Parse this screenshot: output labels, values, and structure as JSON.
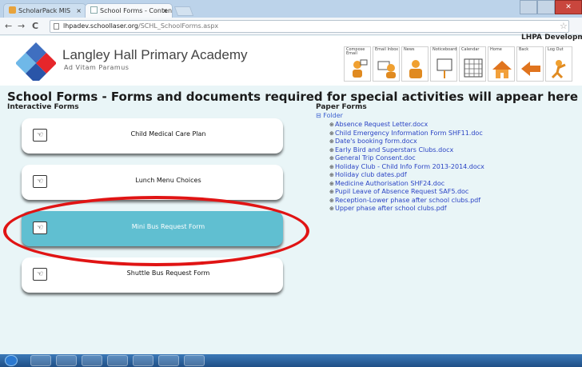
{
  "browser": {
    "tabs": [
      {
        "title": "ScholarPack MIS",
        "active": false
      },
      {
        "title": "School Forms - Content",
        "active": true
      }
    ],
    "address": {
      "host": "lhpadev.schoollaser.org",
      "path": "/SCHL_SchoolForms.aspx"
    }
  },
  "header": {
    "school_name": "Langley Hall Primary Academy",
    "motto": "Ad Vitam Paramus",
    "user_label": "LHPA Developme",
    "nav": [
      {
        "label": "Compose Email",
        "icon": "compose-email-icon"
      },
      {
        "label": "Email Inbox",
        "icon": "email-inbox-icon"
      },
      {
        "label": "News",
        "icon": "news-icon"
      },
      {
        "label": "Noticeboard",
        "icon": "noticeboard-icon"
      },
      {
        "label": "Calendar",
        "icon": "calendar-icon"
      },
      {
        "label": "Home",
        "icon": "home-icon"
      },
      {
        "label": "Back",
        "icon": "back-arrow-icon"
      },
      {
        "label": "Log Out",
        "icon": "log-out-icon"
      }
    ]
  },
  "page": {
    "heading": "School Forms - Forms and documents required for special activities will appear here",
    "interactive_title": "Interactive Forms",
    "paper_title": "Paper Forms",
    "forms": [
      {
        "label": "Child Medical Care Plan",
        "selected": false
      },
      {
        "label": "Lunch Menu Choices",
        "selected": false
      },
      {
        "label": "Mini Bus Request Form",
        "selected": true
      },
      {
        "label": "Shuttle Bus Request Form",
        "selected": false
      }
    ],
    "folder_label": "Folder",
    "files": [
      "Absence Request Letter.docx",
      "Child Emergency Information Form SHF11.doc",
      "Date's booking form.docx",
      "Early Bird and Superstars Clubs.docx",
      "General Trip Consent.doc",
      "Holiday Club - Child Info Form 2013-2014.docx",
      "Holiday club dates.pdf",
      "Medicine Authorisation SHF24.doc",
      "Pupil Leave of Absence Request SAF5.doc",
      "Reception-Lower phase after school clubs.pdf",
      "Upper phase after school clubs.pdf"
    ]
  },
  "colors": {
    "selected_card": "#60bfd1",
    "link": "#2a43c4",
    "annotation": "#e01414"
  }
}
